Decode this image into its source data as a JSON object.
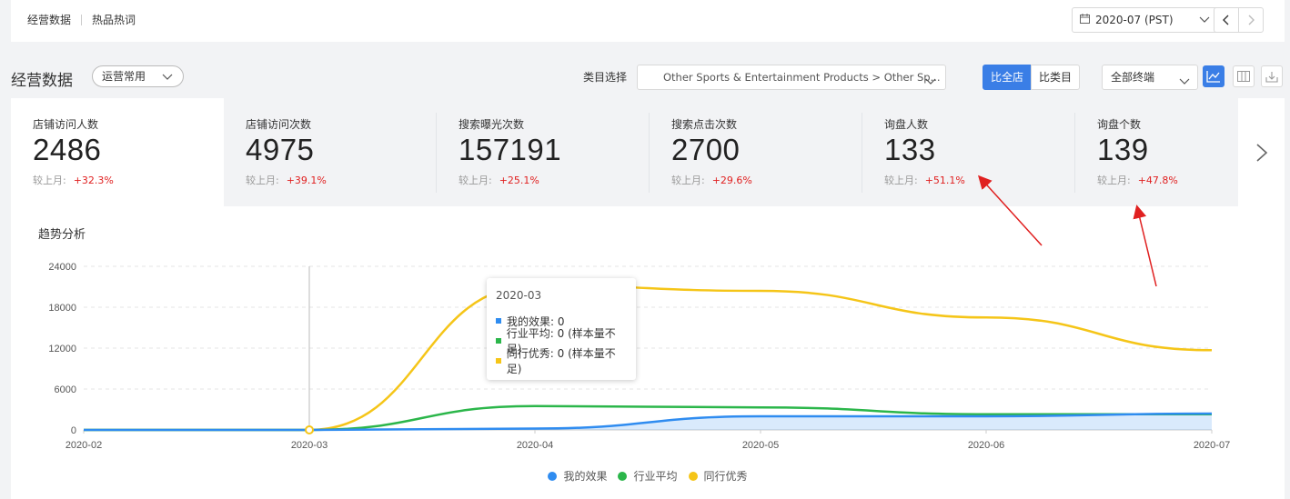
{
  "topnav": {
    "tab1": "经营数据",
    "tab2": "热品热词"
  },
  "month_selector": {
    "value": "2020-07 (PST)"
  },
  "section": {
    "title": "经营数据",
    "pill_value": "运营常用"
  },
  "category": {
    "label": "类目选择",
    "value": "Other Sports & Entertainment Products > Other Sp..."
  },
  "compare": {
    "all_store": "比全店",
    "category": "比类目"
  },
  "terminal": {
    "value": "全部终端"
  },
  "cards": [
    {
      "label": "店铺访问人数",
      "value": "2486",
      "cmp_label": "较上月:",
      "cmp_value": "+32.3%"
    },
    {
      "label": "店铺访问次数",
      "value": "4975",
      "cmp_label": "较上月:",
      "cmp_value": "+39.1%"
    },
    {
      "label": "搜索曝光次数",
      "value": "157191",
      "cmp_label": "较上月:",
      "cmp_value": "+25.1%"
    },
    {
      "label": "搜索点击次数",
      "value": "2700",
      "cmp_label": "较上月:",
      "cmp_value": "+29.6%"
    },
    {
      "label": "询盘人数",
      "value": "133",
      "cmp_label": "较上月:",
      "cmp_value": "+51.1%"
    },
    {
      "label": "询盘个数",
      "value": "139",
      "cmp_label": "较上月:",
      "cmp_value": "+47.8%"
    }
  ],
  "trend": {
    "title": "趋势分析"
  },
  "tooltip": {
    "title": "2020-03",
    "rows": [
      "我的效果: 0",
      "行业平均: 0 (样本量不足)",
      "同行优秀: 0 (样本量不足)"
    ]
  },
  "colors": {
    "mine": "#2f8cf0",
    "industry": "#2bb64a",
    "peer": "#f5c518",
    "accent": "#3a7ee6",
    "up": "#e02020"
  },
  "chart_data": {
    "type": "line",
    "x": [
      "2020-02",
      "2020-03",
      "2020-04",
      "2020-05",
      "2020-06",
      "2020-07"
    ],
    "ylim": [
      0,
      24000
    ],
    "yticks": [
      0,
      6000,
      12000,
      18000,
      24000
    ],
    "series": [
      {
        "name": "我的效果",
        "values": [
          0,
          0,
          200,
          2000,
          2000,
          2400
        ]
      },
      {
        "name": "行业平均",
        "values": [
          0,
          0,
          3500,
          3300,
          2300,
          2300
        ]
      },
      {
        "name": "同行优秀",
        "values": [
          0,
          0,
          21200,
          20400,
          16500,
          11700
        ]
      }
    ],
    "legend": [
      "我的效果",
      "行业平均",
      "同行优秀"
    ],
    "legend_position": "bottom"
  }
}
